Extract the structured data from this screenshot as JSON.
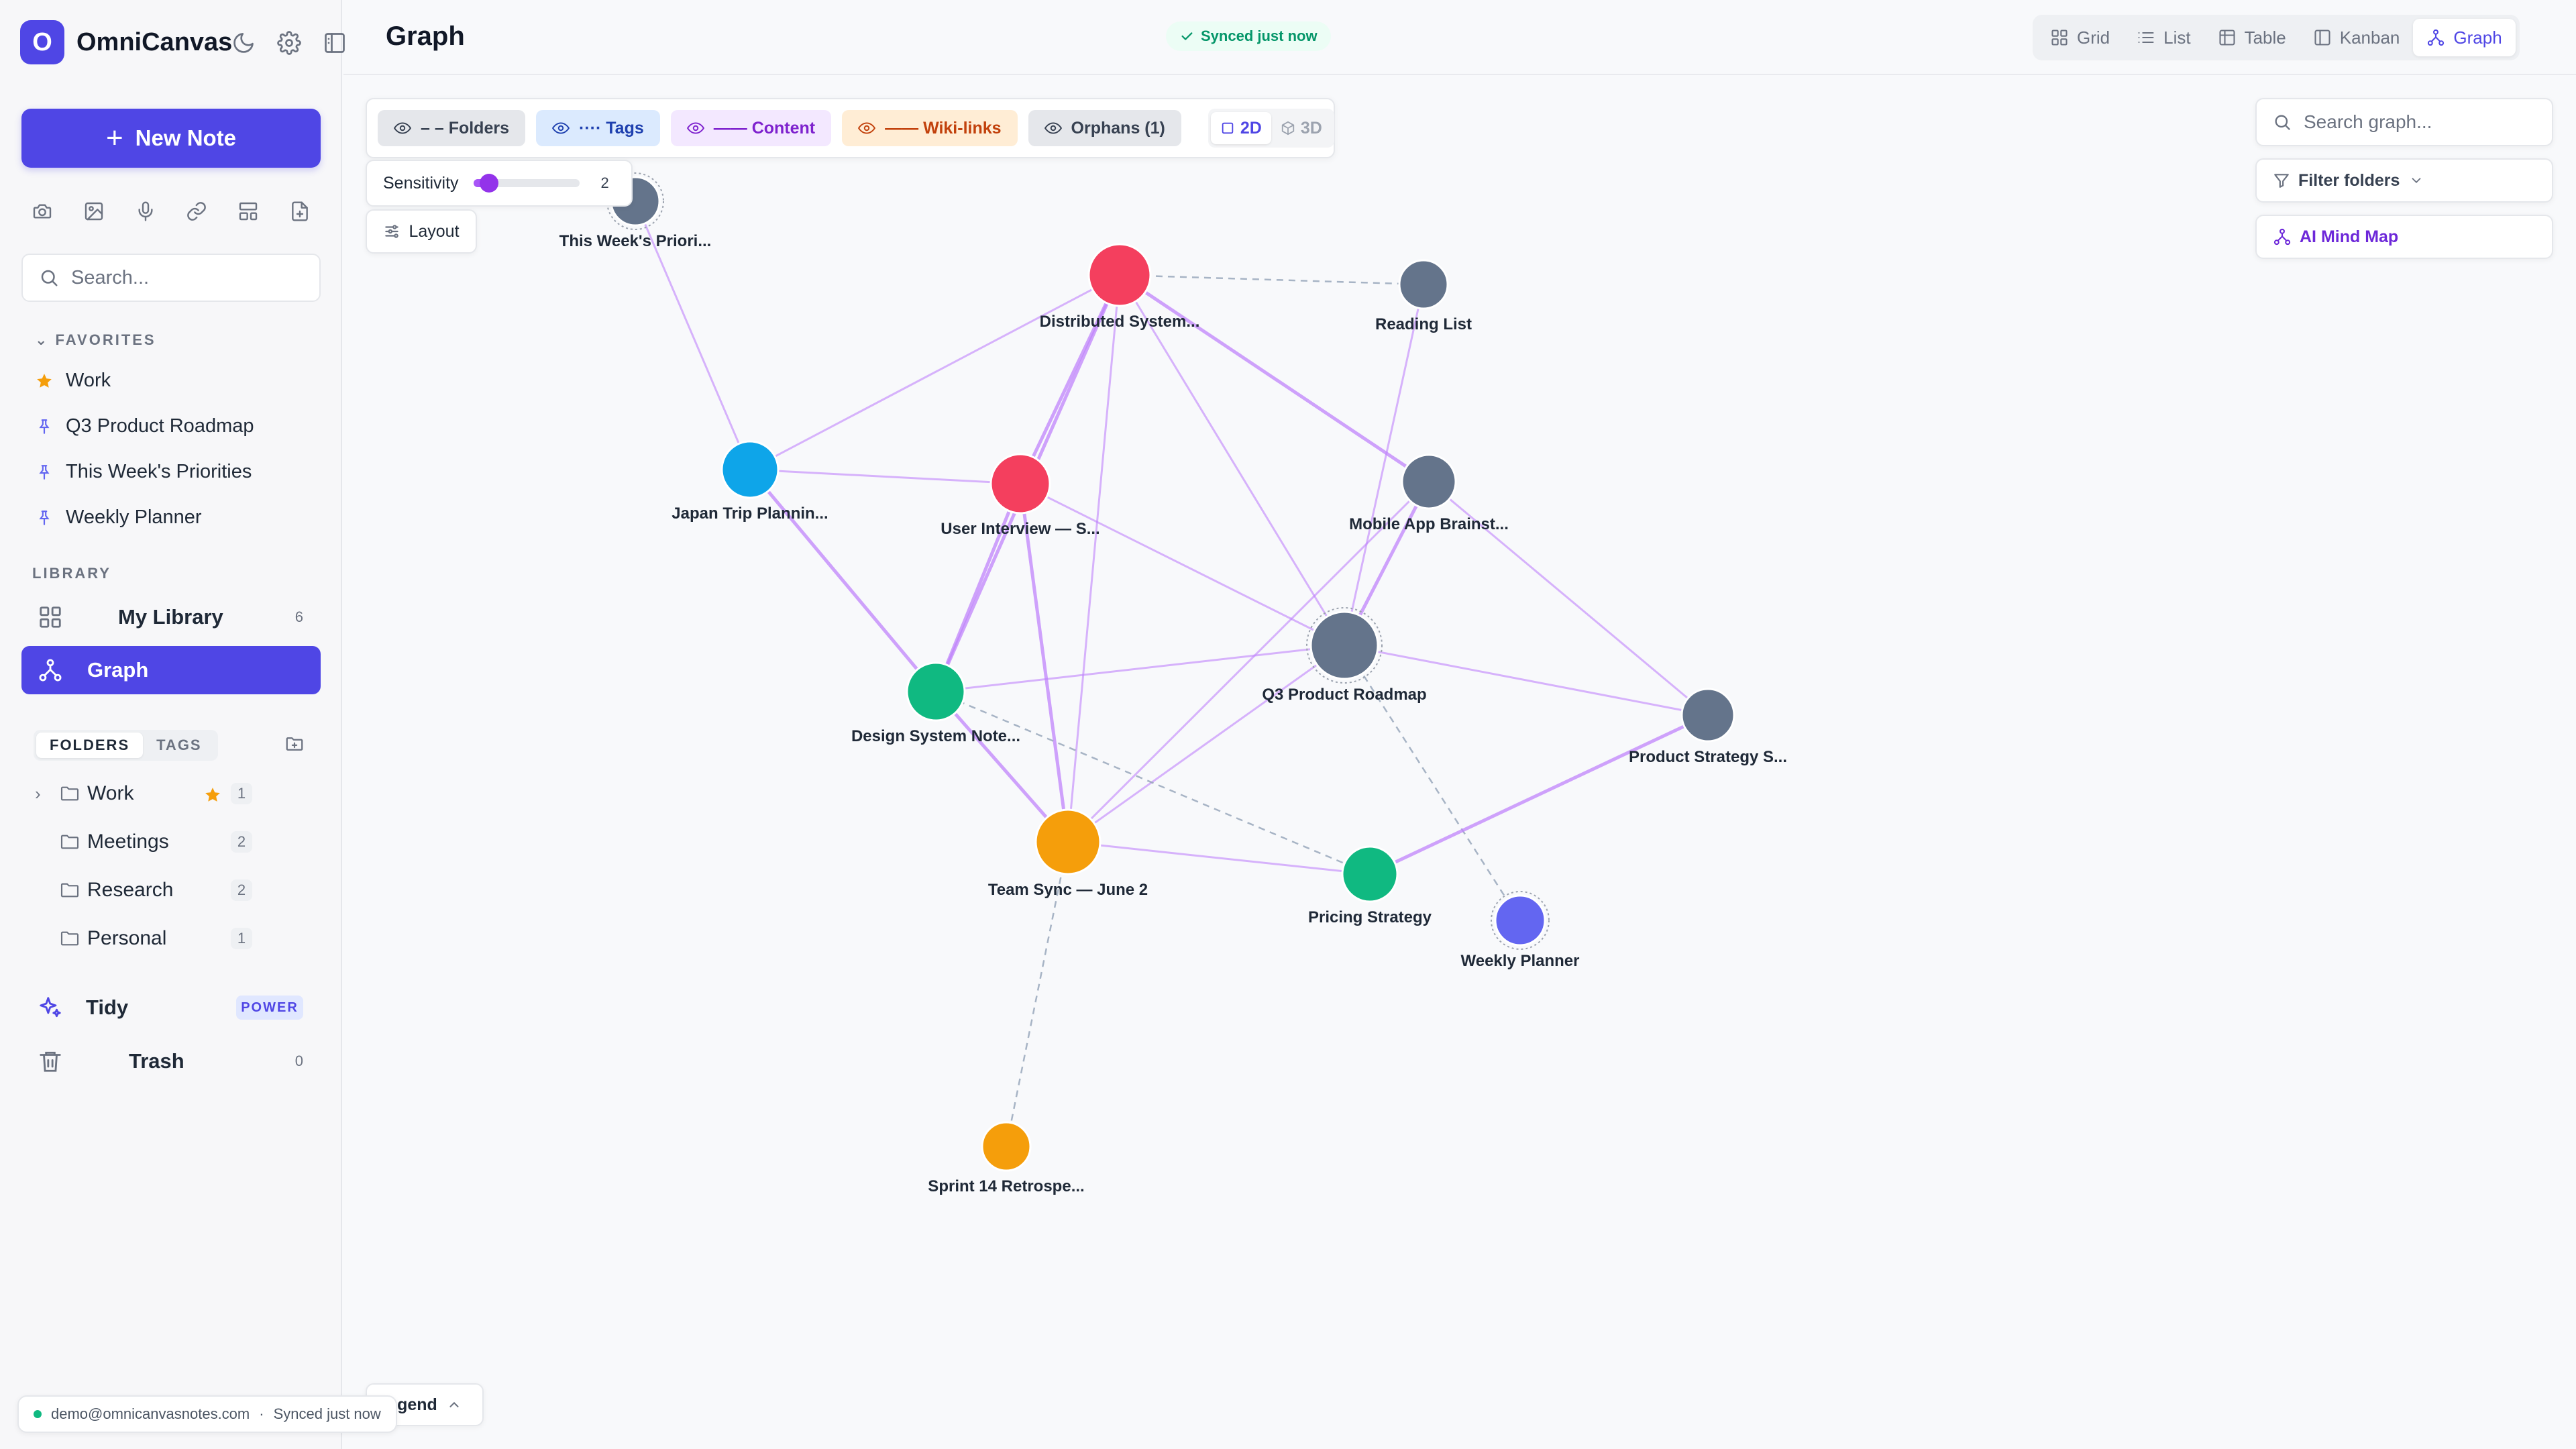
{
  "app": {
    "name": "OmniCanvas",
    "logo_letter": "O"
  },
  "sidebar": {
    "new_note_label": "New Note",
    "search_placeholder": "Search...",
    "quick_actions": [
      "camera-icon",
      "image-icon",
      "mic-icon",
      "link-icon",
      "template-icon",
      "file-icon"
    ],
    "favorites_label": "FAVORITES",
    "favorites": [
      {
        "label": "Work",
        "icon": "star-icon"
      },
      {
        "label": "Q3 Product Roadmap",
        "icon": "pin-icon"
      },
      {
        "label": "This Week's Priorities",
        "icon": "pin-icon"
      },
      {
        "label": "Weekly Planner",
        "icon": "pin-icon"
      }
    ],
    "library_label": "LIBRARY",
    "my_library": {
      "label": "My Library",
      "count": "6"
    },
    "graph": {
      "label": "Graph"
    },
    "tabs": {
      "folders": "FOLDERS",
      "tags": "TAGS"
    },
    "folders": [
      {
        "label": "Work",
        "count": "1",
        "starred": true
      },
      {
        "label": "Meetings",
        "count": "2"
      },
      {
        "label": "Research",
        "count": "2"
      },
      {
        "label": "Personal",
        "count": "1"
      }
    ],
    "tidy": {
      "label": "Tidy",
      "badge": "POWER"
    },
    "trash": {
      "label": "Trash",
      "count": "0"
    },
    "status": {
      "email": "demo@omnicanvasnotes.com",
      "separator": "·",
      "sync": "Synced just now"
    }
  },
  "header": {
    "title": "Graph",
    "sync_badge": "Synced just now",
    "views": [
      {
        "label": "Grid",
        "icon": "grid-icon"
      },
      {
        "label": "List",
        "icon": "list-icon"
      },
      {
        "label": "Table",
        "icon": "table-icon"
      },
      {
        "label": "Kanban",
        "icon": "kanban-icon"
      },
      {
        "label": "Graph",
        "icon": "graph-icon",
        "active": true
      }
    ]
  },
  "graph": {
    "filters": {
      "folders": "– – Folders",
      "tags": "···· Tags",
      "content": "—— Content",
      "wiki_links": "—— Wiki-links",
      "orphans": "Orphans (1)"
    },
    "dimension": {
      "two_d": "2D",
      "three_d": "3D",
      "active": "2D"
    },
    "sensitivity": {
      "label": "Sensitivity",
      "value": "2",
      "fraction": 0.15
    },
    "layout_label": "Layout",
    "search_placeholder": "Search graph...",
    "filter_folders_label": "Filter folders",
    "ai_mind_map_label": "AI Mind Map",
    "legend_label": "egend",
    "colors": {
      "gray": "#64748b",
      "red": "#f43f5e",
      "blue": "#0ea5e9",
      "green": "#10b981",
      "orange": "#f59e0b",
      "indigo": "#6366f1",
      "edge": "#c084fc",
      "edge_dashed": "#94a3b8"
    },
    "nodes": [
      {
        "id": "priorities",
        "label": "This Week's Priori...",
        "color": "gray"
      },
      {
        "id": "distributed",
        "label": "Distributed System...",
        "color": "red"
      },
      {
        "id": "reading",
        "label": "Reading List",
        "color": "gray"
      },
      {
        "id": "japan",
        "label": "Japan Trip Plannin...",
        "color": "blue"
      },
      {
        "id": "interview",
        "label": "User Interview — S...",
        "color": "red"
      },
      {
        "id": "mobile",
        "label": "Mobile App Brainst...",
        "color": "gray"
      },
      {
        "id": "q3",
        "label": "Q3 Product Roadmap",
        "color": "gray"
      },
      {
        "id": "design",
        "label": "Design System Note...",
        "color": "green"
      },
      {
        "id": "strategy",
        "label": "Product Strategy S...",
        "color": "gray"
      },
      {
        "id": "teamsync",
        "label": "Team Sync — June 2",
        "color": "orange"
      },
      {
        "id": "pricing",
        "label": "Pricing Strategy",
        "color": "green"
      },
      {
        "id": "weekly",
        "label": "Weekly Planner",
        "color": "indigo"
      },
      {
        "id": "sprint",
        "label": "Sprint 14 Retrospe...",
        "color": "orange"
      }
    ],
    "edges": [
      [
        "priorities",
        "japan",
        "solid"
      ],
      [
        "distributed",
        "japan",
        "solid"
      ],
      [
        "distributed",
        "interview",
        "strong"
      ],
      [
        "distributed",
        "design",
        "strong"
      ],
      [
        "distributed",
        "teamsync",
        "solid"
      ],
      [
        "distributed",
        "q3",
        "solid"
      ],
      [
        "distributed",
        "mobile",
        "strong"
      ],
      [
        "distributed",
        "reading",
        "dashed"
      ],
      [
        "reading",
        "q3",
        "solid"
      ],
      [
        "japan",
        "interview",
        "solid"
      ],
      [
        "japan",
        "design",
        "strong"
      ],
      [
        "interview",
        "design",
        "strong"
      ],
      [
        "interview",
        "teamsync",
        "strong"
      ],
      [
        "interview",
        "q3",
        "solid"
      ],
      [
        "mobile",
        "q3",
        "strong"
      ],
      [
        "mobile",
        "teamsync",
        "solid"
      ],
      [
        "mobile",
        "strategy",
        "solid"
      ],
      [
        "q3",
        "design",
        "solid"
      ],
      [
        "q3",
        "teamsync",
        "solid"
      ],
      [
        "q3",
        "strategy",
        "solid"
      ],
      [
        "q3",
        "weekly",
        "dashed"
      ],
      [
        "design",
        "teamsync",
        "strong"
      ],
      [
        "design",
        "pricing",
        "dashed"
      ],
      [
        "teamsync",
        "pricing",
        "solid"
      ],
      [
        "teamsync",
        "sprint",
        "dashed"
      ],
      [
        "pricing",
        "strategy",
        "strong"
      ]
    ]
  }
}
